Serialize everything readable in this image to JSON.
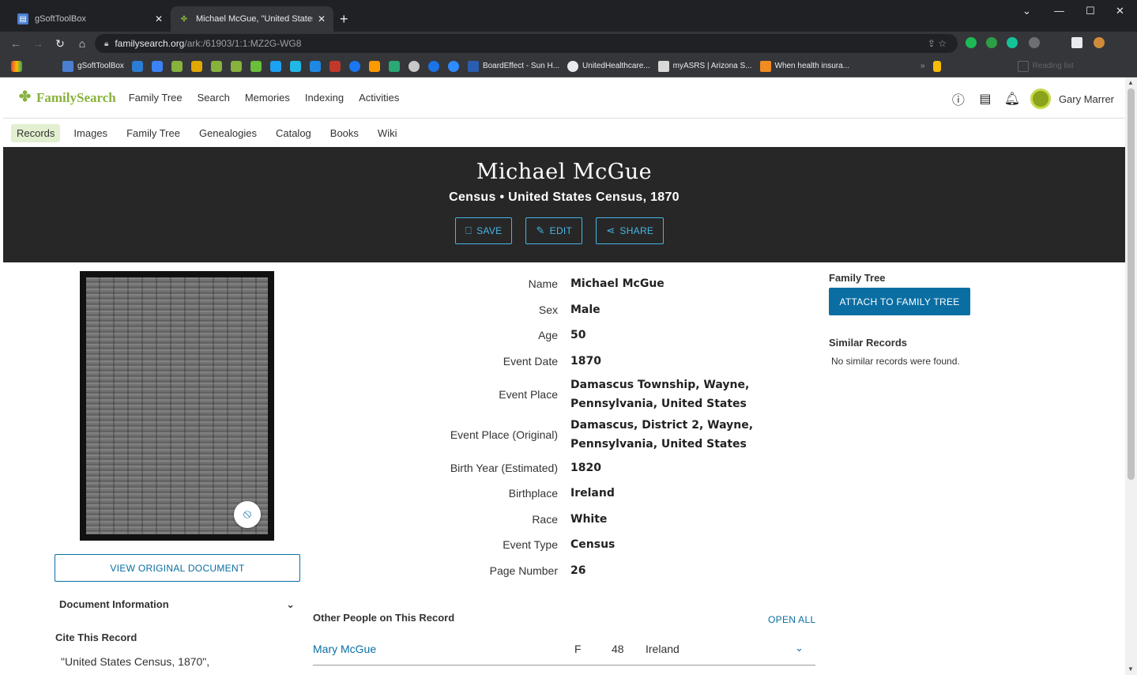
{
  "browser": {
    "tabs": [
      {
        "title": "gSoftToolBox",
        "active": false
      },
      {
        "title": "Michael McGue, \"United States C",
        "active": true
      }
    ],
    "url_host": "familysearch.org",
    "url_path": "/ark:/61903/1:1:MZ2G-WG8",
    "bookmarks": [
      "gSoftToolBox",
      "BoardEffect - Sun H...",
      "UnitedHealthcare...",
      "myASRS | Arizona S...",
      "When health insura..."
    ],
    "reading_list": "Reading list"
  },
  "site": {
    "logo": "FamilySearch",
    "nav": [
      "Family Tree",
      "Search",
      "Memories",
      "Indexing",
      "Activities"
    ],
    "user_name": "Gary Marrer",
    "subnav": [
      "Records",
      "Images",
      "Family Tree",
      "Genealogies",
      "Catalog",
      "Books",
      "Wiki"
    ]
  },
  "record": {
    "name": "Michael McGue",
    "subtitle": "Census • United States Census, 1870",
    "actions": {
      "save": "SAVE",
      "edit": "EDIT",
      "share": "SHARE"
    },
    "view_original": "VIEW ORIGINAL DOCUMENT",
    "document_information": "Document Information",
    "cite_heading": "Cite This Record",
    "cite_text": "\"United States Census, 1870\",",
    "facts": [
      {
        "label": "Name",
        "value": "Michael McGue"
      },
      {
        "label": "Sex",
        "value": "Male"
      },
      {
        "label": "Age",
        "value": "50"
      },
      {
        "label": "Event Date",
        "value": "1870"
      },
      {
        "label": "Event Place",
        "value": "Damascus Township, Wayne, Pennsylvania, United States"
      },
      {
        "label": "Event Place (Original)",
        "value": "Damascus, District 2, Wayne, Pennsylvania, United States"
      },
      {
        "label": "Birth Year (Estimated)",
        "value": "1820"
      },
      {
        "label": "Birthplace",
        "value": "Ireland"
      },
      {
        "label": "Race",
        "value": "White"
      },
      {
        "label": "Event Type",
        "value": "Census"
      },
      {
        "label": "Page Number",
        "value": "26"
      }
    ]
  },
  "sidebar": {
    "family_tree_heading": "Family Tree",
    "attach_button": "ATTACH TO FAMILY TREE",
    "similar_heading": "Similar Records",
    "similar_text": "No similar records were found."
  },
  "other_people": {
    "heading": "Other People on This Record",
    "open_all": "OPEN ALL",
    "rows": [
      {
        "name": "Mary McGue",
        "sex": "F",
        "age": "48",
        "birthplace": "Ireland"
      }
    ]
  }
}
